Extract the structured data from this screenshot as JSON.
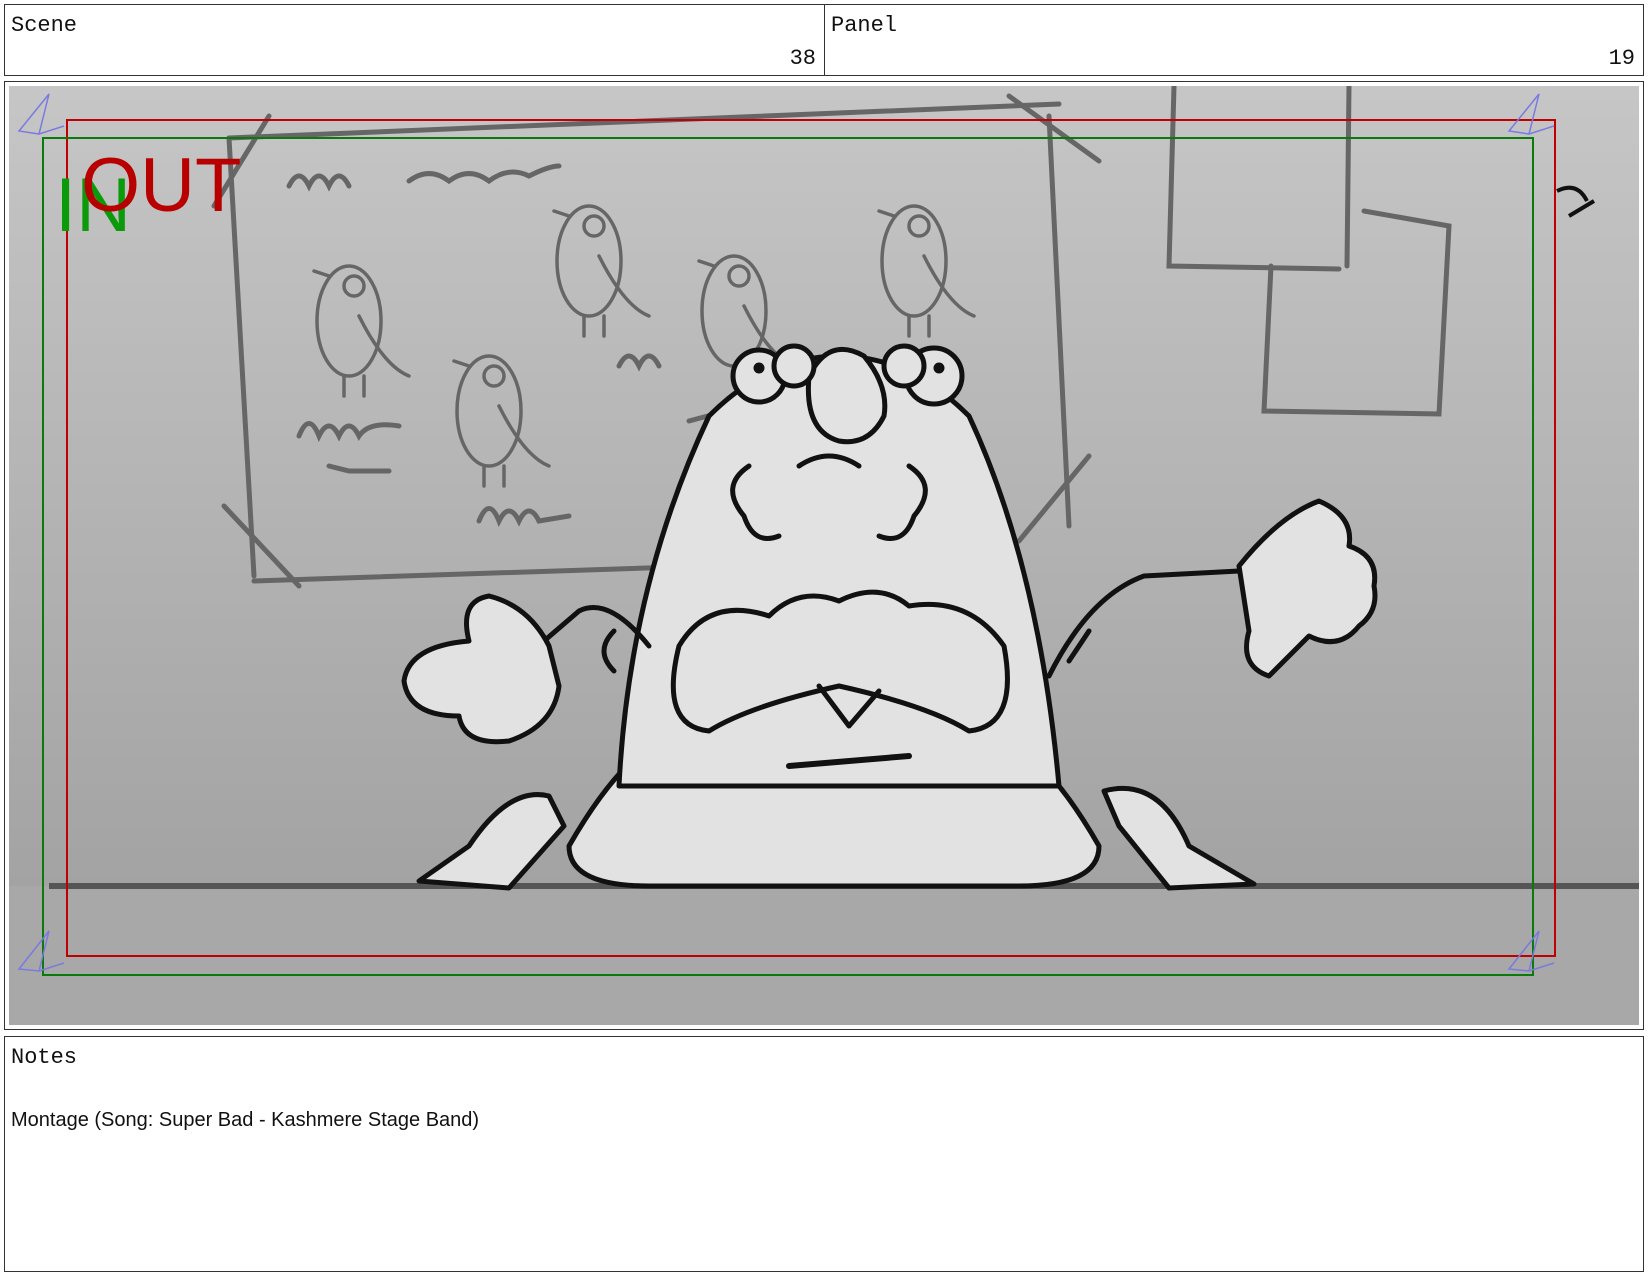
{
  "header": {
    "scene_label": "Scene",
    "scene_value": "38",
    "panel_label": "Panel",
    "panel_value": "19"
  },
  "frame": {
    "in_label": "IN",
    "out_label": "OUT",
    "in_color": "#0a9a0a",
    "out_color": "#b80000",
    "safe_in_color": "#0a7a0a",
    "safe_out_color": "#c00000",
    "corner_marker_color": "#6a6ad8"
  },
  "notes": {
    "label": "Notes",
    "text": "Montage (Song: Super Bad - Kashmere Stage Band)"
  }
}
